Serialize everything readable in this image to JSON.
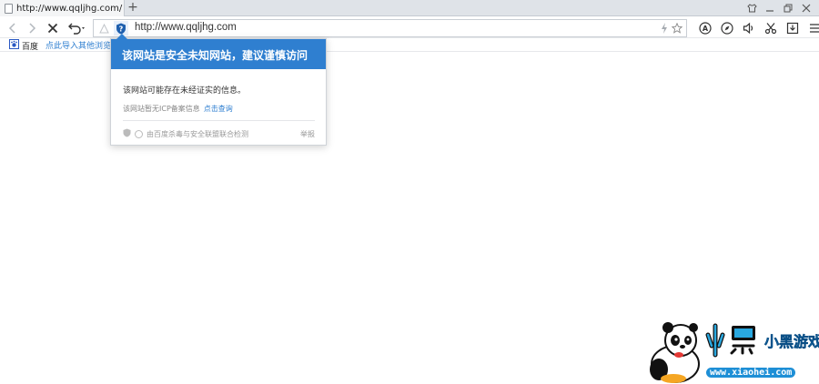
{
  "tab": {
    "title": "http://www.qqljhg.com/"
  },
  "tabbar": {
    "new_tab": "+"
  },
  "address": {
    "url": "http://www.qqljhg.com"
  },
  "bookmarks": [
    {
      "label": "百度"
    },
    {
      "label": "点此导入其他浏览器"
    }
  ],
  "security_popup": {
    "title": "该网站是安全未知网站，建议谨慎访问",
    "message": "该网站可能存在未经证实的信息。",
    "icp_text": "该网站暂无ICP备案信息",
    "icp_link": "点击查询",
    "footer_text": "由百度杀毒与安全联盟联合检测",
    "report_label": "举报"
  },
  "watermark": {
    "site": "www.xiaohei.com",
    "brand": "小黑游戏"
  },
  "colors": {
    "accent": "#2f7fd0",
    "shield": "#1e5fae"
  }
}
